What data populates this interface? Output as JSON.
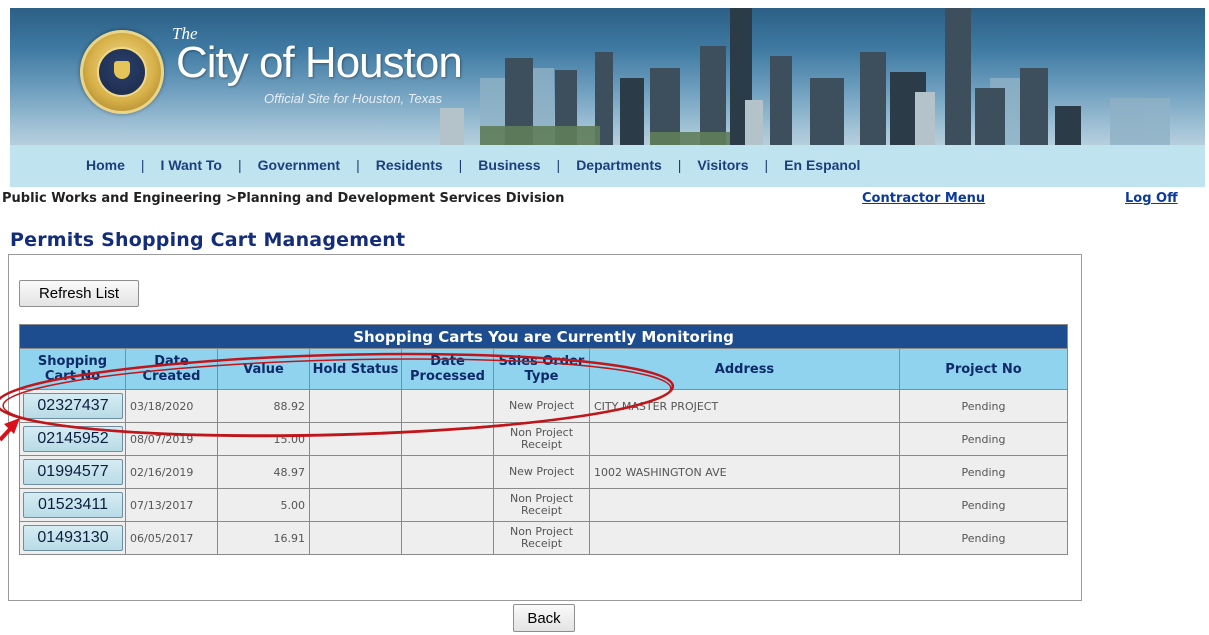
{
  "banner": {
    "the": "The",
    "city_name": "City of Houston",
    "subtitle": "Official Site for Houston, Texas"
  },
  "nav": {
    "items": [
      "Home",
      "I Want To",
      "Government",
      "Residents",
      "Business",
      "Departments",
      "Visitors",
      "En Espanol"
    ]
  },
  "breadcrumb": "Public Works and Engineering >Planning and Development Services Division",
  "contractor_menu": "Contractor Menu",
  "log_off": "Log Off",
  "page_title": "Permits Shopping Cart Management",
  "refresh_label": "Refresh List",
  "back_label": "Back",
  "table": {
    "caption": "Shopping Carts You are Currently Monitoring",
    "headers": {
      "cart_no": "Shopping Cart No",
      "date_created": "Date Created",
      "value": "Value",
      "hold_status": "Hold Status",
      "date_processed": "Date Processed",
      "order_type": "Sales Order Type",
      "address": "Address",
      "project_no": "Project No"
    },
    "rows": [
      {
        "cart_no": "02327437",
        "date_created": "03/18/2020",
        "value": "88.92",
        "hold_status": "",
        "date_processed": "",
        "order_type": "New Project",
        "address": "CITY MASTER PROJECT",
        "project_no": "Pending"
      },
      {
        "cart_no": "02145952",
        "date_created": "08/07/2019",
        "value": "15.00",
        "hold_status": "",
        "date_processed": "",
        "order_type": "Non Project Receipt",
        "address": "",
        "project_no": "Pending"
      },
      {
        "cart_no": "01994577",
        "date_created": "02/16/2019",
        "value": "48.97",
        "hold_status": "",
        "date_processed": "",
        "order_type": "New Project",
        "address": "1002 WASHINGTON AVE",
        "project_no": "Pending"
      },
      {
        "cart_no": "01523411",
        "date_created": "07/13/2017",
        "value": "5.00",
        "hold_status": "",
        "date_processed": "",
        "order_type": "Non Project Receipt",
        "address": "",
        "project_no": "Pending"
      },
      {
        "cart_no": "01493130",
        "date_created": "06/05/2017",
        "value": "16.91",
        "hold_status": "",
        "date_processed": "",
        "order_type": "Non Project Receipt",
        "address": "",
        "project_no": "Pending"
      }
    ]
  },
  "colors": {
    "caption_bg": "#1d4d8e",
    "header_bg": "#8fd3ef",
    "nav_bg": "#bfe4ef",
    "annotation": "#c0161b"
  },
  "icons": {
    "seal": "city-seal-icon",
    "annotation_arrow": "red-arrow-icon"
  }
}
